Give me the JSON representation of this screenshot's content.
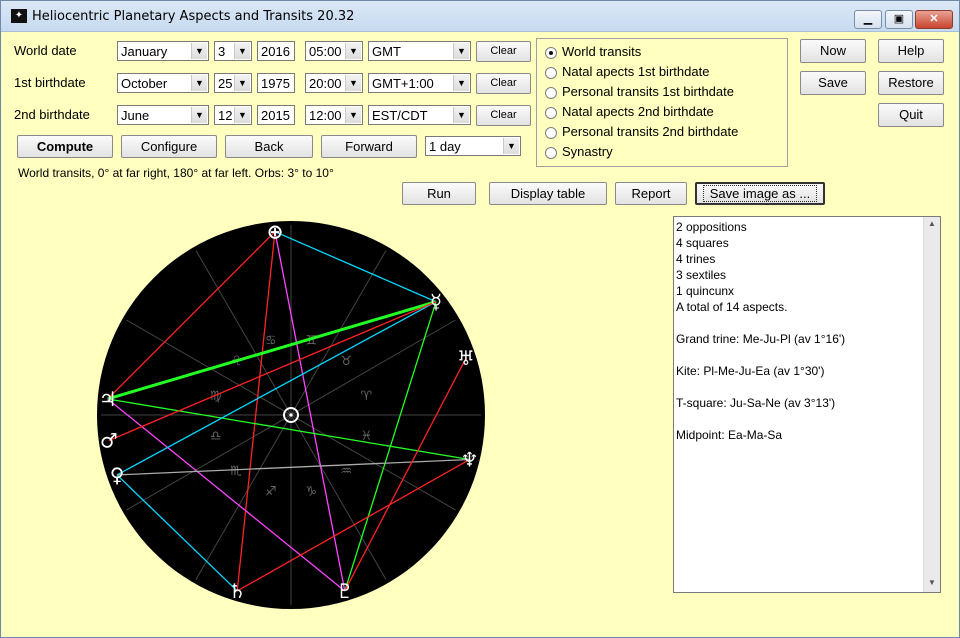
{
  "window": {
    "title": "Heliocentric Planetary Aspects and Transits 20.32",
    "minimize_glyph": "▁",
    "maximize_glyph": "▣",
    "close_glyph": "✕"
  },
  "rows": [
    {
      "label": "World date",
      "month": "January",
      "day": "3",
      "year": "2016",
      "time": "05:00",
      "zone": "GMT",
      "clear": "Clear"
    },
    {
      "label": "1st birthdate",
      "month": "October",
      "day": "25",
      "year": "1975",
      "time": "20:00",
      "zone": "GMT+1:00",
      "clear": "Clear"
    },
    {
      "label": "2nd birthdate",
      "month": "June",
      "day": "12",
      "year": "2015",
      "time": "12:00",
      "zone": "EST/CDT",
      "clear": "Clear"
    }
  ],
  "nav": {
    "compute": "Compute",
    "configure": "Configure",
    "back": "Back",
    "forward": "Forward",
    "step": "1 day"
  },
  "modes": [
    {
      "label": "World transits",
      "selected": true
    },
    {
      "label": "Natal apects 1st birthdate",
      "selected": false
    },
    {
      "label": "Personal transits 1st birthdate",
      "selected": false
    },
    {
      "label": "Natal apects 2nd birthdate",
      "selected": false
    },
    {
      "label": "Personal transits 2nd birthdate",
      "selected": false
    },
    {
      "label": "Synastry",
      "selected": false
    }
  ],
  "side_buttons": {
    "now": "Now",
    "help": "Help",
    "save": "Save",
    "restore": "Restore",
    "quit": "Quit"
  },
  "info": "World transits, 0° at far right, 180° at far left.  Orbs: 3° to 10°",
  "actions": {
    "run": "Run",
    "display_table": "Display table",
    "report": "Report",
    "save_image": "Save image as ..."
  },
  "results": [
    "2 oppositions",
    "4 squares",
    "4 trines",
    "3 sextiles",
    "1 quincunx",
    "A total of 14 aspects.",
    "",
    "Grand trine: Me-Ju-Pl (av 1°16')",
    "",
    "Kite: Pl-Me-Ju-Ea (av 1°30')",
    "",
    "T-square: Ju-Sa-Ne (av 3°13')",
    "",
    "Midpoint: Ea-Ma-Sa"
  ],
  "wheel": {
    "center_symbol": "☉",
    "planets": [
      {
        "name": "Earth",
        "glyph": "⊕",
        "angle": 95
      },
      {
        "name": "Mercury",
        "glyph": "☿",
        "angle": 38
      },
      {
        "name": "Uranus",
        "glyph": "♅",
        "angle": 18
      },
      {
        "name": "Neptune",
        "glyph": "♆",
        "angle": -14
      },
      {
        "name": "Pluto",
        "glyph": "♇",
        "angle": -73
      },
      {
        "name": "Saturn",
        "glyph": "♄",
        "angle": -107
      },
      {
        "name": "Venus",
        "glyph": "♀",
        "angle": -161
      },
      {
        "name": "Mars",
        "glyph": "♂",
        "angle": -172
      },
      {
        "name": "Jupiter",
        "glyph": "♃",
        "angle": 175
      }
    ],
    "signs": [
      "♈",
      "♉",
      "♊",
      "♋",
      "♌",
      "♍",
      "♎",
      "♏",
      "♐",
      "♑",
      "♒",
      "♓"
    ],
    "aspects": [
      {
        "from": "Earth",
        "to": "Mercury",
        "color": "#00d8ff"
      },
      {
        "from": "Earth",
        "to": "Jupiter",
        "color": "#ff2222"
      },
      {
        "from": "Earth",
        "to": "Pluto",
        "color": "#ff44ff"
      },
      {
        "from": "Earth",
        "to": "Saturn",
        "color": "#ff2222"
      },
      {
        "from": "Jupiter",
        "to": "Mercury",
        "color": "#22ff22"
      },
      {
        "from": "Jupiter",
        "to": "Neptune",
        "color": "#22ff22"
      },
      {
        "from": "Jupiter",
        "to": "Pluto",
        "color": "#ff44ff"
      },
      {
        "from": "Mercury",
        "to": "Pluto",
        "color": "#22ff22"
      },
      {
        "from": "Mercury",
        "to": "Venus",
        "color": "#00d8ff"
      },
      {
        "from": "Venus",
        "to": "Saturn",
        "color": "#00d8ff"
      },
      {
        "from": "Venus",
        "to": "Neptune",
        "color": "#aaaaaa"
      },
      {
        "from": "Saturn",
        "to": "Neptune",
        "color": "#ff2222"
      },
      {
        "from": "Uranus",
        "to": "Pluto",
        "color": "#ff2222"
      },
      {
        "from": "Mars",
        "to": "Mercury",
        "color": "#ff2222"
      }
    ]
  }
}
